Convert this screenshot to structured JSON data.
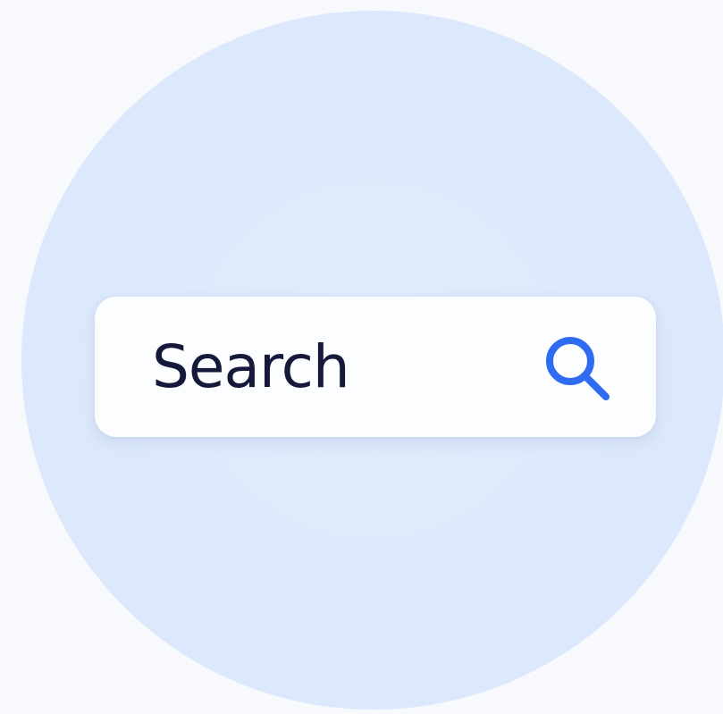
{
  "search": {
    "placeholder": "Search",
    "icon": "search-icon"
  },
  "colors": {
    "page_background": "#f7f9fd",
    "circle": "#dde9fb",
    "search_bar": "#fcfdff",
    "text": "#151a3a",
    "accent": "#2f6bf0"
  }
}
